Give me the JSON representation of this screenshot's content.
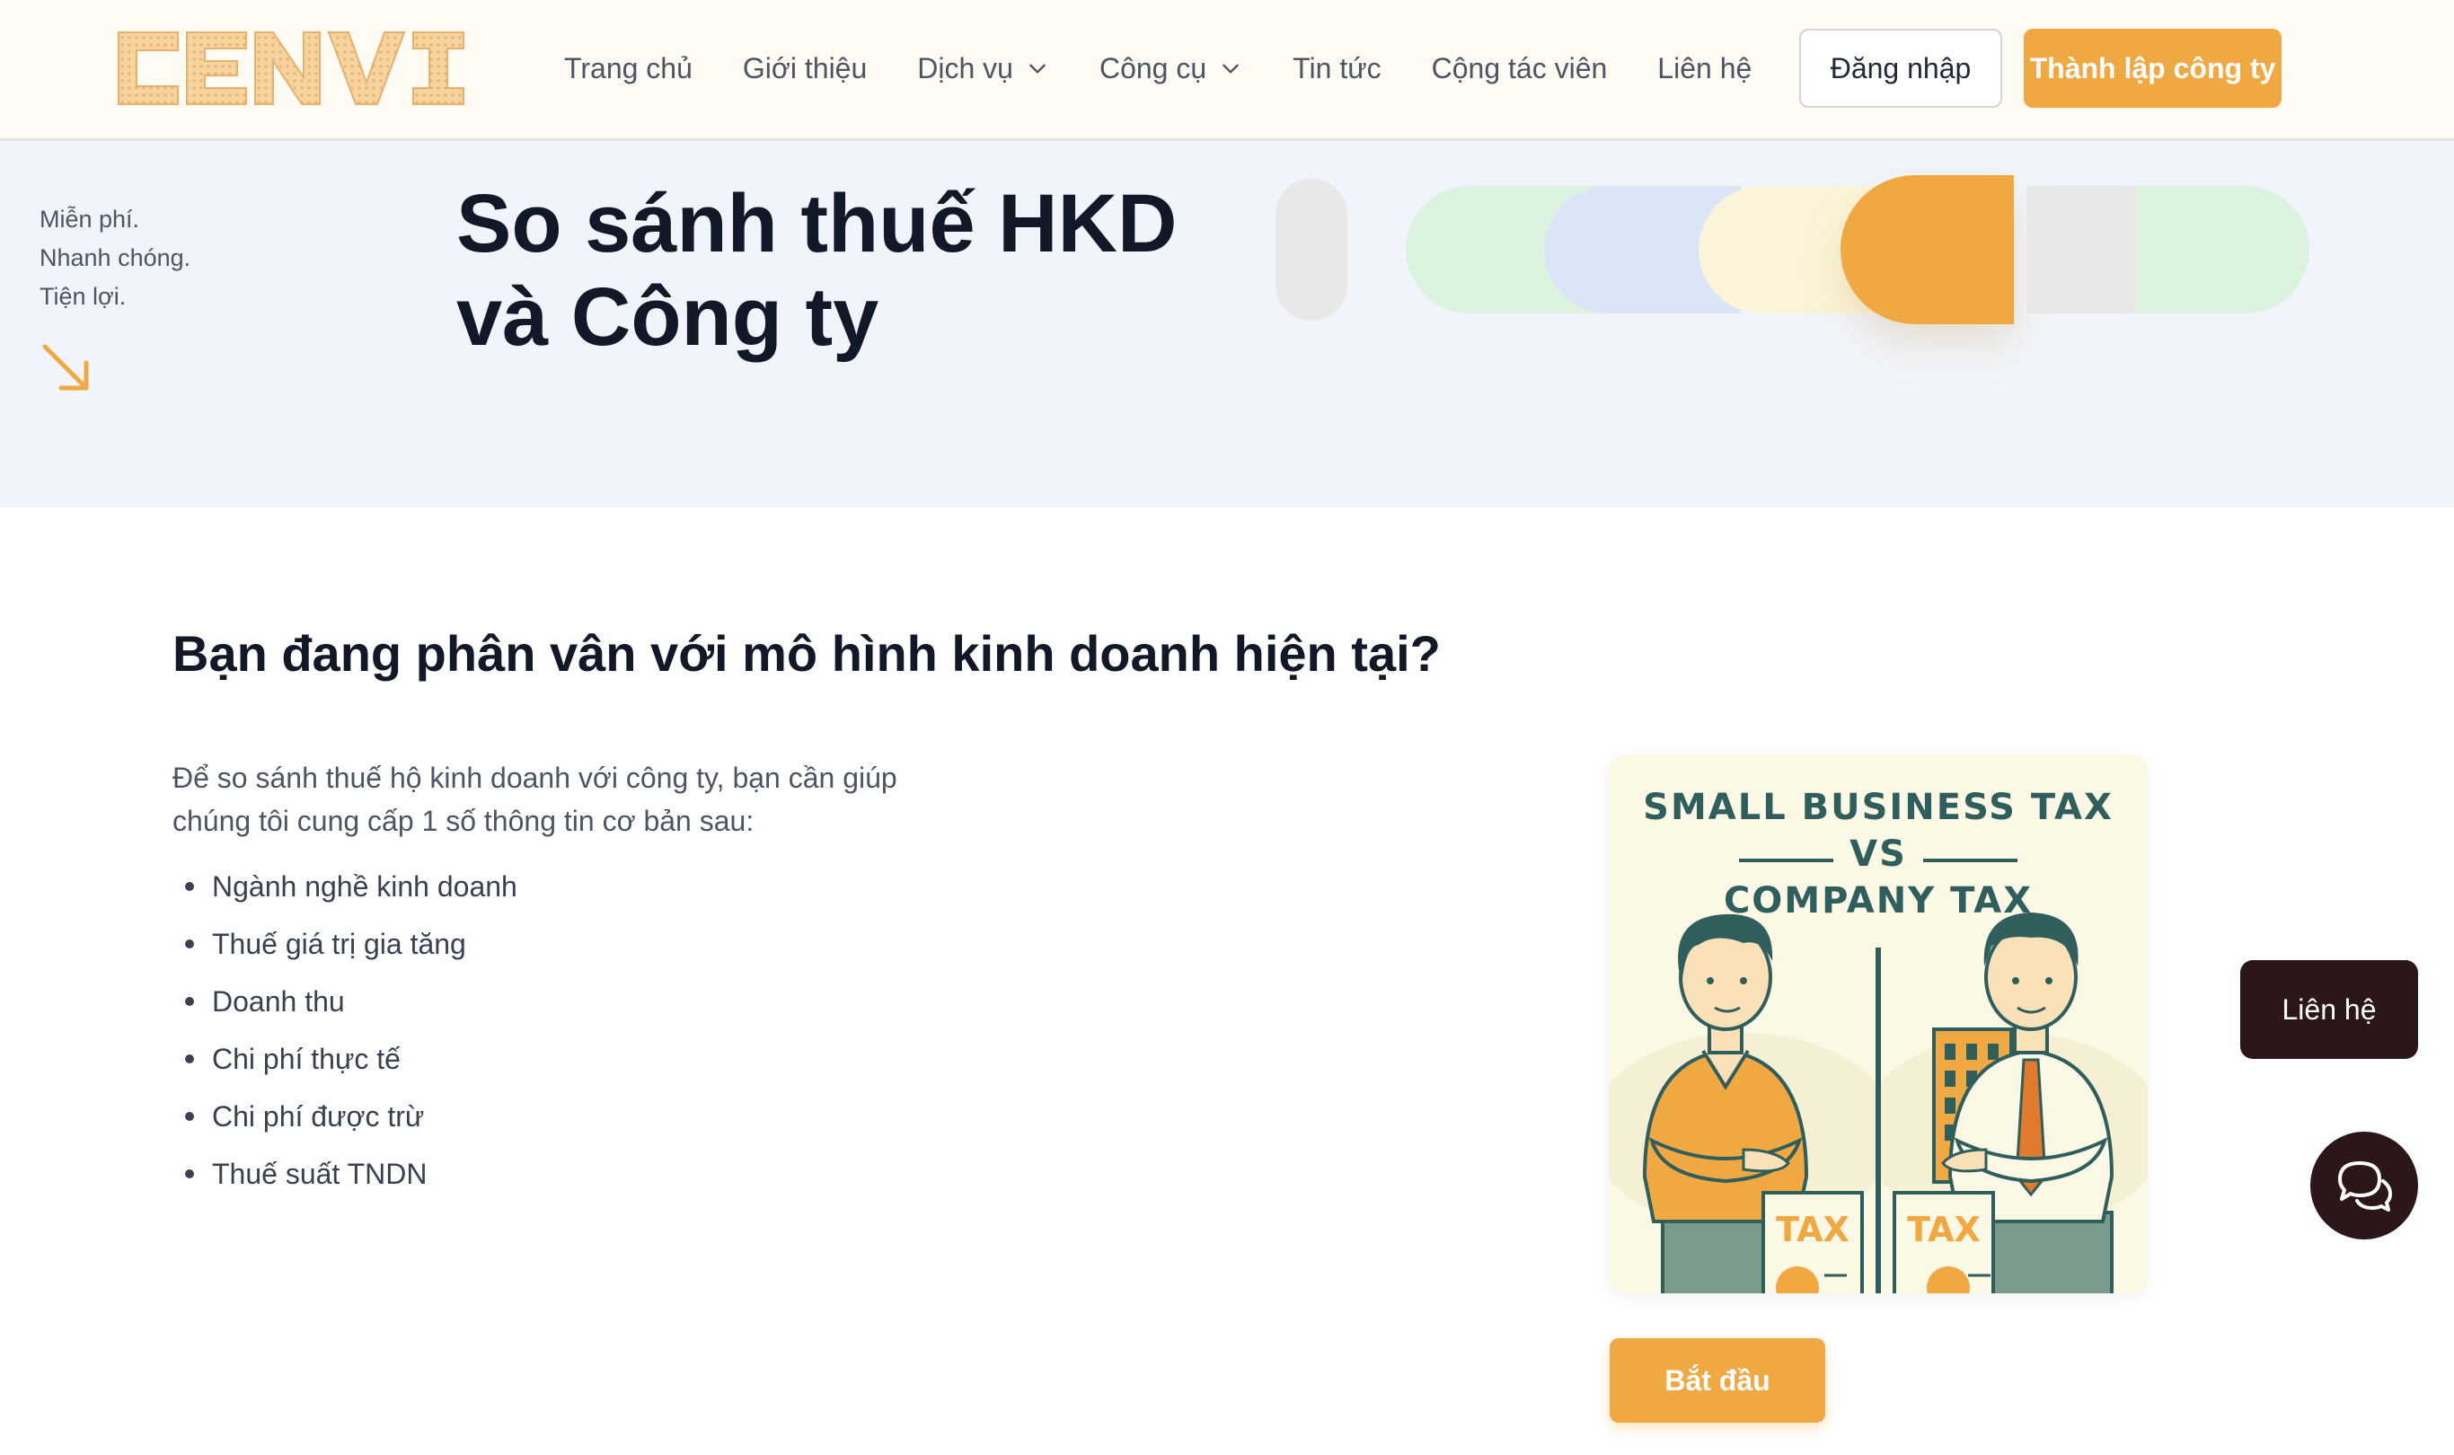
{
  "header": {
    "logo_text": "CENVI",
    "nav": [
      {
        "label": "Trang chủ"
      },
      {
        "label": "Giới thiệu"
      },
      {
        "label": "Dịch vụ"
      },
      {
        "label": "Công cụ"
      },
      {
        "label": "Tin tức"
      },
      {
        "label": "Cộng tác viên"
      },
      {
        "label": "Liên hệ"
      }
    ],
    "login_label": "Đăng nhập",
    "found_label": "Thành lập công ty"
  },
  "hero": {
    "tagline": [
      "Miễn phí.",
      "Nhanh chóng.",
      "Tiện lợi."
    ],
    "title_line1": "So sánh thuế HKD",
    "title_line2": "và Công ty"
  },
  "main": {
    "heading": "Bạn đang phân vân với mô hình kinh doanh hiện tại?",
    "intro_line1": "Để so sánh thuế hộ kinh doanh với công ty, bạn cần giúp",
    "intro_line2": "chúng tôi cung cấp 1 số thông tin cơ bản sau:",
    "requirements": [
      "Ngành nghề kinh doanh",
      "Thuế giá trị gia tăng",
      "Doanh thu",
      "Chi phí thực tế",
      "Chi phí được trừ",
      "Thuế suất TNDN"
    ],
    "illustration": {
      "line1": "SMALL BUSINESS TAX",
      "line2": "VS",
      "line3": "COMPANY TAX",
      "tax_left": "TAX",
      "tax_right": "TAX"
    },
    "start_label": "Bắt đầu"
  },
  "floating": {
    "contact_label": "Liên hệ"
  },
  "colors": {
    "accent": "#f0a843",
    "header_bg": "#fdfbf3",
    "hero_bg": "#f1f5fb",
    "dark": "#2b1618",
    "illus_teal": "#2f5e5d"
  },
  "icons": [
    "chevron-down-icon",
    "arrow-down-right-icon",
    "chat-bubbles-icon"
  ]
}
